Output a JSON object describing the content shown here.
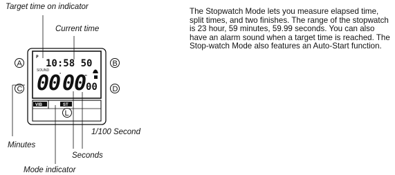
{
  "figure": {
    "callouts": {
      "target_time": "Target time on indicator",
      "current_time": "Current time",
      "one_hundredth": "1/100 Second",
      "seconds": "Seconds",
      "minutes": "Minutes",
      "mode_indicator": "Mode indicator"
    },
    "watch": {
      "buttons": {
        "a": "A",
        "b": "B",
        "c": "C",
        "d": "D",
        "l": "L"
      },
      "display": {
        "p_mark": "P",
        "top_time": "10:58 50",
        "sound_label": "SOUND",
        "minutes": "00",
        "seconds": "00",
        "hundredths": "00",
        "vib_label": "VIB",
        "mode_label": "ST"
      }
    }
  },
  "description": "The Stopwatch Mode lets you measure elapsed time, split times, and two finishes. The range of the stopwatch is 23 hour, 59 minutes, 59.99 seconds. You can also have an alarm sound when a target time is reached. The Stop-watch Mode also features an Auto-Start function."
}
